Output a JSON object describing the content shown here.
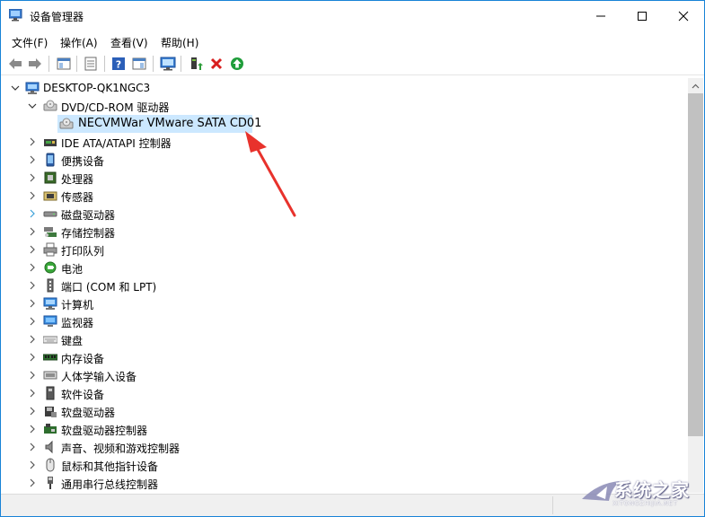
{
  "window": {
    "title": "设备管理器",
    "controls": {
      "minimize": "minimize-icon",
      "maximize": "maximize-icon",
      "close": "close-icon"
    }
  },
  "menu": [
    "文件(F)",
    "操作(A)",
    "查看(V)",
    "帮助(H)"
  ],
  "toolbar": [
    "back-icon",
    "forward-icon",
    "show-hide-tree-icon",
    "properties-icon",
    "help-icon",
    "view-pane-icon",
    "monitor-icon",
    "update-driver-icon",
    "uninstall-icon",
    "enable-device-icon"
  ],
  "tree": {
    "root": "DESKTOP-QK1NGC3",
    "categories": [
      {
        "label": "DVD/CD-ROM 驱动器",
        "icon": "dvd-drive-icon",
        "expanded": true,
        "children": [
          "NECVMWar VMware SATA CD01"
        ]
      },
      {
        "label": "IDE ATA/ATAPI 控制器",
        "icon": "ide-controller-icon"
      },
      {
        "label": "便携设备",
        "icon": "portable-device-icon"
      },
      {
        "label": "处理器",
        "icon": "processor-icon"
      },
      {
        "label": "传感器",
        "icon": "sensor-icon"
      },
      {
        "label": "磁盘驱动器",
        "icon": "disk-drive-icon"
      },
      {
        "label": "存储控制器",
        "icon": "storage-controller-icon"
      },
      {
        "label": "打印队列",
        "icon": "print-queue-icon"
      },
      {
        "label": "电池",
        "icon": "battery-icon"
      },
      {
        "label": "端口 (COM 和 LPT)",
        "icon": "port-icon"
      },
      {
        "label": "计算机",
        "icon": "computer-icon"
      },
      {
        "label": "监视器",
        "icon": "monitor-icon"
      },
      {
        "label": "键盘",
        "icon": "keyboard-icon"
      },
      {
        "label": "内存设备",
        "icon": "memory-icon"
      },
      {
        "label": "人体学输入设备",
        "icon": "hid-icon"
      },
      {
        "label": "软件设备",
        "icon": "software-device-icon"
      },
      {
        "label": "软盘驱动器",
        "icon": "floppy-drive-icon"
      },
      {
        "label": "软盘驱动器控制器",
        "icon": "floppy-controller-icon"
      },
      {
        "label": "声音、视频和游戏控制器",
        "icon": "sound-icon"
      },
      {
        "label": "鼠标和其他指针设备",
        "icon": "mouse-icon"
      },
      {
        "label": "通用串行总线控制器",
        "icon": "usb-icon"
      }
    ]
  },
  "watermark": {
    "text": "系统之家",
    "sub": "XITONGZHIJIA.NET"
  },
  "colors": {
    "selection": "#cce8ff",
    "window_border": "#1883d7",
    "arrow": "#e8322c"
  }
}
